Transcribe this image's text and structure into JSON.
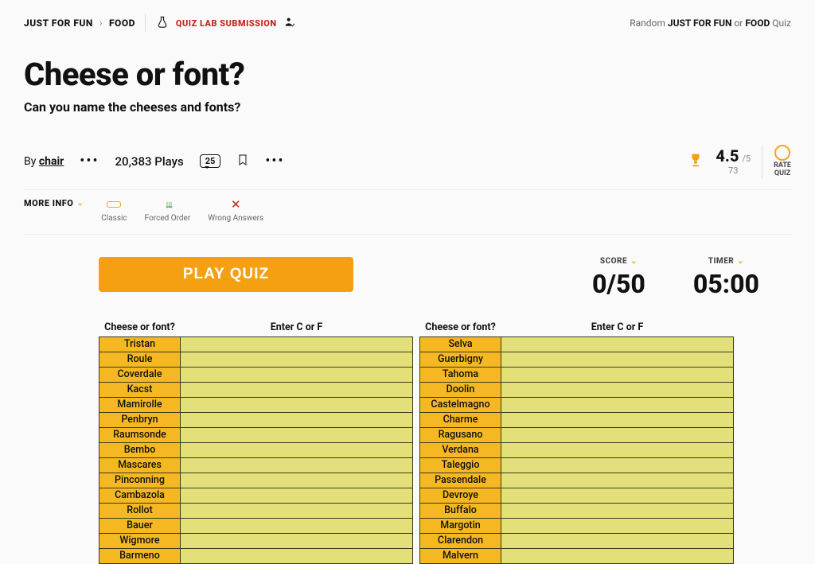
{
  "crumbs": {
    "root": "JUST FOR FUN",
    "leaf": "FOOD"
  },
  "lab": "QUIZ LAB SUBMISSION",
  "top_right": {
    "pre": "Random ",
    "a": "JUST FOR FUN",
    "mid": " or ",
    "b": "FOOD",
    "post": " Quiz"
  },
  "title": "Cheese or font?",
  "subtitle": "Can you name the cheeses and fonts?",
  "byline_pre": "By ",
  "author": "chair",
  "plays": "20,383 Plays",
  "comments": "25",
  "rating": {
    "value": "4.5",
    "of": "/5",
    "votes": "73"
  },
  "rate_quiz": "RATE\nQUIZ",
  "more_info": "MORE INFO",
  "tags": {
    "classic": "Classic",
    "forced": "Forced Order",
    "wrong": "Wrong Answers"
  },
  "play": "PLAY QUIZ",
  "score_label": "SCORE",
  "timer_label": "TIMER",
  "score": "0/50",
  "timer": "05:00",
  "headers": {
    "name": "Cheese or font?",
    "ans": "Enter C or F"
  },
  "left": [
    "Tristan",
    "Roule",
    "Coverdale",
    "Kacst",
    "Mamirolle",
    "Penbryn",
    "Raumsonde",
    "Bembo",
    "Mascares",
    "Pinconning",
    "Cambazola",
    "Rollot",
    "Bauer",
    "Wigmore",
    "Barmeno"
  ],
  "right": [
    "Selva",
    "Guerbigny",
    "Tahoma",
    "Doolin",
    "Castelmagno",
    "Charme",
    "Ragusano",
    "Verdana",
    "Taleggio",
    "Passendale",
    "Devroye",
    "Buffalo",
    "Margotin",
    "Clarendon",
    "Malvern"
  ]
}
